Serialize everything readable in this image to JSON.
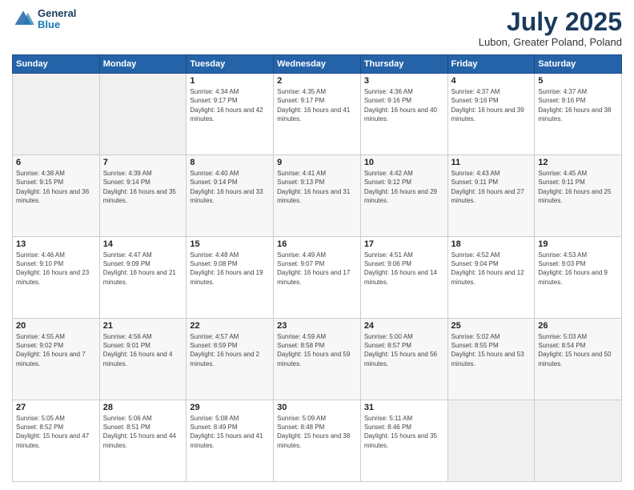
{
  "logo": {
    "line1": "General",
    "line2": "Blue"
  },
  "title": "July 2025",
  "subtitle": "Lubon, Greater Poland, Poland",
  "weekdays": [
    "Sunday",
    "Monday",
    "Tuesday",
    "Wednesday",
    "Thursday",
    "Friday",
    "Saturday"
  ],
  "weeks": [
    [
      {
        "day": "",
        "sunrise": "",
        "sunset": "",
        "daylight": ""
      },
      {
        "day": "",
        "sunrise": "",
        "sunset": "",
        "daylight": ""
      },
      {
        "day": "1",
        "sunrise": "Sunrise: 4:34 AM",
        "sunset": "Sunset: 9:17 PM",
        "daylight": "Daylight: 16 hours and 42 minutes."
      },
      {
        "day": "2",
        "sunrise": "Sunrise: 4:35 AM",
        "sunset": "Sunset: 9:17 PM",
        "daylight": "Daylight: 16 hours and 41 minutes."
      },
      {
        "day": "3",
        "sunrise": "Sunrise: 4:36 AM",
        "sunset": "Sunset: 9:16 PM",
        "daylight": "Daylight: 16 hours and 40 minutes."
      },
      {
        "day": "4",
        "sunrise": "Sunrise: 4:37 AM",
        "sunset": "Sunset: 9:16 PM",
        "daylight": "Daylight: 16 hours and 39 minutes."
      },
      {
        "day": "5",
        "sunrise": "Sunrise: 4:37 AM",
        "sunset": "Sunset: 9:16 PM",
        "daylight": "Daylight: 16 hours and 38 minutes."
      }
    ],
    [
      {
        "day": "6",
        "sunrise": "Sunrise: 4:38 AM",
        "sunset": "Sunset: 9:15 PM",
        "daylight": "Daylight: 16 hours and 36 minutes."
      },
      {
        "day": "7",
        "sunrise": "Sunrise: 4:39 AM",
        "sunset": "Sunset: 9:14 PM",
        "daylight": "Daylight: 16 hours and 35 minutes."
      },
      {
        "day": "8",
        "sunrise": "Sunrise: 4:40 AM",
        "sunset": "Sunset: 9:14 PM",
        "daylight": "Daylight: 16 hours and 33 minutes."
      },
      {
        "day": "9",
        "sunrise": "Sunrise: 4:41 AM",
        "sunset": "Sunset: 9:13 PM",
        "daylight": "Daylight: 16 hours and 31 minutes."
      },
      {
        "day": "10",
        "sunrise": "Sunrise: 4:42 AM",
        "sunset": "Sunset: 9:12 PM",
        "daylight": "Daylight: 16 hours and 29 minutes."
      },
      {
        "day": "11",
        "sunrise": "Sunrise: 4:43 AM",
        "sunset": "Sunset: 9:11 PM",
        "daylight": "Daylight: 16 hours and 27 minutes."
      },
      {
        "day": "12",
        "sunrise": "Sunrise: 4:45 AM",
        "sunset": "Sunset: 9:11 PM",
        "daylight": "Daylight: 16 hours and 25 minutes."
      }
    ],
    [
      {
        "day": "13",
        "sunrise": "Sunrise: 4:46 AM",
        "sunset": "Sunset: 9:10 PM",
        "daylight": "Daylight: 16 hours and 23 minutes."
      },
      {
        "day": "14",
        "sunrise": "Sunrise: 4:47 AM",
        "sunset": "Sunset: 9:09 PM",
        "daylight": "Daylight: 16 hours and 21 minutes."
      },
      {
        "day": "15",
        "sunrise": "Sunrise: 4:48 AM",
        "sunset": "Sunset: 9:08 PM",
        "daylight": "Daylight: 16 hours and 19 minutes."
      },
      {
        "day": "16",
        "sunrise": "Sunrise: 4:49 AM",
        "sunset": "Sunset: 9:07 PM",
        "daylight": "Daylight: 16 hours and 17 minutes."
      },
      {
        "day": "17",
        "sunrise": "Sunrise: 4:51 AM",
        "sunset": "Sunset: 9:06 PM",
        "daylight": "Daylight: 16 hours and 14 minutes."
      },
      {
        "day": "18",
        "sunrise": "Sunrise: 4:52 AM",
        "sunset": "Sunset: 9:04 PM",
        "daylight": "Daylight: 16 hours and 12 minutes."
      },
      {
        "day": "19",
        "sunrise": "Sunrise: 4:53 AM",
        "sunset": "Sunset: 9:03 PM",
        "daylight": "Daylight: 16 hours and 9 minutes."
      }
    ],
    [
      {
        "day": "20",
        "sunrise": "Sunrise: 4:55 AM",
        "sunset": "Sunset: 9:02 PM",
        "daylight": "Daylight: 16 hours and 7 minutes."
      },
      {
        "day": "21",
        "sunrise": "Sunrise: 4:56 AM",
        "sunset": "Sunset: 9:01 PM",
        "daylight": "Daylight: 16 hours and 4 minutes."
      },
      {
        "day": "22",
        "sunrise": "Sunrise: 4:57 AM",
        "sunset": "Sunset: 8:59 PM",
        "daylight": "Daylight: 16 hours and 2 minutes."
      },
      {
        "day": "23",
        "sunrise": "Sunrise: 4:59 AM",
        "sunset": "Sunset: 8:58 PM",
        "daylight": "Daylight: 15 hours and 59 minutes."
      },
      {
        "day": "24",
        "sunrise": "Sunrise: 5:00 AM",
        "sunset": "Sunset: 8:57 PM",
        "daylight": "Daylight: 15 hours and 56 minutes."
      },
      {
        "day": "25",
        "sunrise": "Sunrise: 5:02 AM",
        "sunset": "Sunset: 8:55 PM",
        "daylight": "Daylight: 15 hours and 53 minutes."
      },
      {
        "day": "26",
        "sunrise": "Sunrise: 5:03 AM",
        "sunset": "Sunset: 8:54 PM",
        "daylight": "Daylight: 15 hours and 50 minutes."
      }
    ],
    [
      {
        "day": "27",
        "sunrise": "Sunrise: 5:05 AM",
        "sunset": "Sunset: 8:52 PM",
        "daylight": "Daylight: 15 hours and 47 minutes."
      },
      {
        "day": "28",
        "sunrise": "Sunrise: 5:06 AM",
        "sunset": "Sunset: 8:51 PM",
        "daylight": "Daylight: 15 hours and 44 minutes."
      },
      {
        "day": "29",
        "sunrise": "Sunrise: 5:08 AM",
        "sunset": "Sunset: 8:49 PM",
        "daylight": "Daylight: 15 hours and 41 minutes."
      },
      {
        "day": "30",
        "sunrise": "Sunrise: 5:09 AM",
        "sunset": "Sunset: 8:48 PM",
        "daylight": "Daylight: 15 hours and 38 minutes."
      },
      {
        "day": "31",
        "sunrise": "Sunrise: 5:11 AM",
        "sunset": "Sunset: 8:46 PM",
        "daylight": "Daylight: 15 hours and 35 minutes."
      },
      {
        "day": "",
        "sunrise": "",
        "sunset": "",
        "daylight": ""
      },
      {
        "day": "",
        "sunrise": "",
        "sunset": "",
        "daylight": ""
      }
    ]
  ]
}
